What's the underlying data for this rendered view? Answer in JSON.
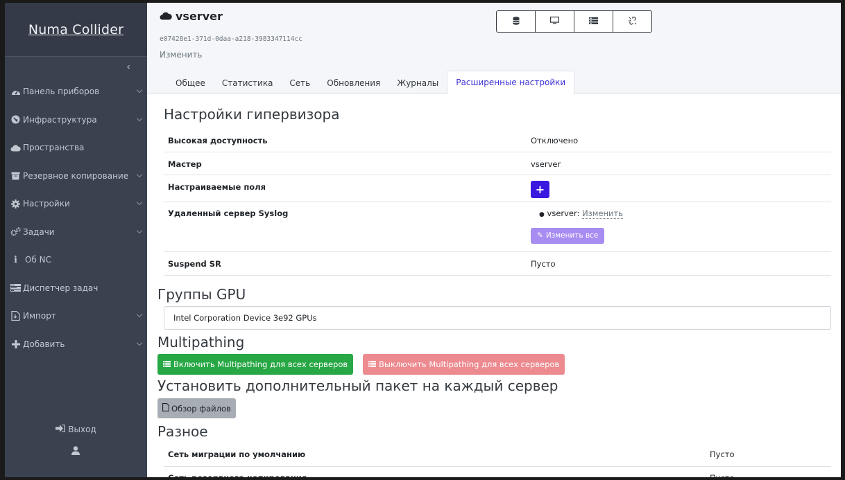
{
  "brand": {
    "name": "Numa Collider"
  },
  "sidebar": {
    "items": [
      {
        "label": "Панель приборов",
        "icon": "dashboard-icon",
        "has_chevron": true
      },
      {
        "label": "Инфраструктура",
        "icon": "globe-icon",
        "has_chevron": true
      },
      {
        "label": "Пространства",
        "icon": "cloud-icon",
        "has_chevron": false
      },
      {
        "label": "Резервное копирование",
        "icon": "archive-icon",
        "has_chevron": true
      },
      {
        "label": "Настройки",
        "icon": "gear-icon",
        "has_chevron": true
      },
      {
        "label": "Задачи",
        "icon": "cogs-icon",
        "has_chevron": true
      },
      {
        "label": "Об NC",
        "icon": "info-icon",
        "has_chevron": false
      },
      {
        "label": "Диспетчер задач",
        "icon": "tasks-icon",
        "has_chevron": false
      },
      {
        "label": "Импорт",
        "icon": "file-import-icon",
        "has_chevron": true
      },
      {
        "label": "Добавить",
        "icon": "plus-icon",
        "has_chevron": true
      }
    ],
    "logout_label": "Выход"
  },
  "header": {
    "title": "vserver",
    "uuid": "e07428e1-371d-0daa-a218-3983347114cc",
    "edit_label": "Изменить",
    "buttons": [
      "database-icon",
      "monitor-icon",
      "server-icon",
      "unlink-icon"
    ],
    "tabs": [
      "Общее",
      "Статистика",
      "Сеть",
      "Обновления",
      "Журналы",
      "Расширенные настройки"
    ],
    "active_tab": "Расширенные настройки"
  },
  "hypervisor": {
    "heading": "Настройки гипервизора",
    "ha_label": "Высокая доступность",
    "ha_value": "Отключено",
    "master_label": "Мастер",
    "master_value": "vserver",
    "custom_fields_label": "Настраиваемые поля",
    "syslog_label": "Удаленный сервер Syslog",
    "syslog_host": "vserver",
    "syslog_edit": "Изменить",
    "edit_all_label": "Изменить все",
    "suspend_label": "Suspend SR",
    "suspend_value": "Пусто"
  },
  "gpu": {
    "heading": "Группы GPU",
    "group": "Intel Corporation Device 3e92 GPUs"
  },
  "multipathing": {
    "heading": "Multipathing",
    "enable_label": "Включить Multipathing для всех серверов",
    "disable_label": "Выключить Multipathing для всех серверов"
  },
  "package": {
    "heading": "Установить дополнительный пакет на каждый сервер",
    "browse_label": "Обзор файлов"
  },
  "misc": {
    "heading": "Разное",
    "migration_label": "Сеть миграции по умолчанию",
    "migration_value": "Пусто",
    "backup_label": "Сеть резервного копирования",
    "backup_value": "Пусто"
  },
  "colors": {
    "sidebar_bg": "#3a4250",
    "accent_blue": "#3b18e0",
    "success": "#28a745",
    "danger_light": "#ec8a8f"
  }
}
